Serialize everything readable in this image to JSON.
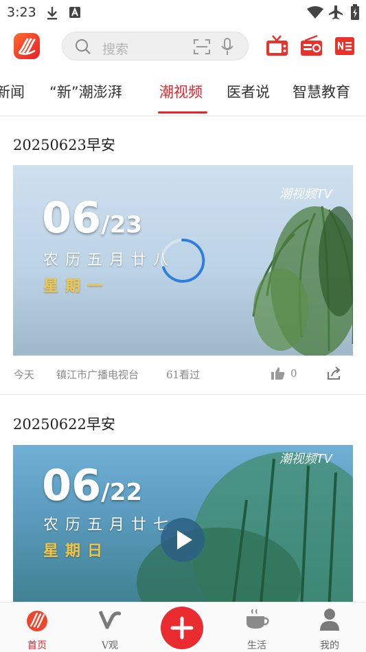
{
  "status_bar": {
    "time": "3:23",
    "icons": [
      "download-icon",
      "font-icon",
      "wifi-icon",
      "airplane-icon",
      "battery-icon"
    ]
  },
  "header": {
    "search_placeholder": "搜索",
    "icons": [
      "app-logo-icon",
      "search-icon",
      "scan-icon",
      "mic-icon",
      "tv-icon",
      "radio-icon",
      "news-paper-icon"
    ]
  },
  "tabs": [
    {
      "label": "新闻"
    },
    {
      "label": "“新”潮澎湃"
    },
    {
      "label": "潮视频",
      "active": true
    },
    {
      "label": "医者说"
    },
    {
      "label": "智慧教育"
    }
  ],
  "feed": [
    {
      "title": "20250623早安",
      "thumb": {
        "day": "06",
        "month_day": "/23",
        "lunar": "农历五月廿八",
        "weekday": "星期一",
        "brand": "潮视频TV",
        "state": "loading"
      },
      "meta": {
        "time": "今天",
        "source": "镇江市广播电视台",
        "views": "61看过",
        "likes": "0"
      }
    },
    {
      "title": "20250622早安",
      "thumb": {
        "day": "06",
        "month_day": "/22",
        "lunar": "农历五月廿七",
        "weekday": "星期日",
        "brand": "潮视频TV",
        "state": "play"
      }
    }
  ],
  "bottom_nav": [
    {
      "label": "首页",
      "icon": "home-logo-icon",
      "active": true
    },
    {
      "label": "V观",
      "icon": "v-icon"
    },
    {
      "label": "",
      "icon": "plus-icon"
    },
    {
      "label": "生活",
      "icon": "coffee-cup-icon"
    },
    {
      "label": "我的",
      "icon": "user-icon"
    }
  ],
  "colors": {
    "accent": "#e0262c",
    "meta_text": "#8a8a8a"
  }
}
